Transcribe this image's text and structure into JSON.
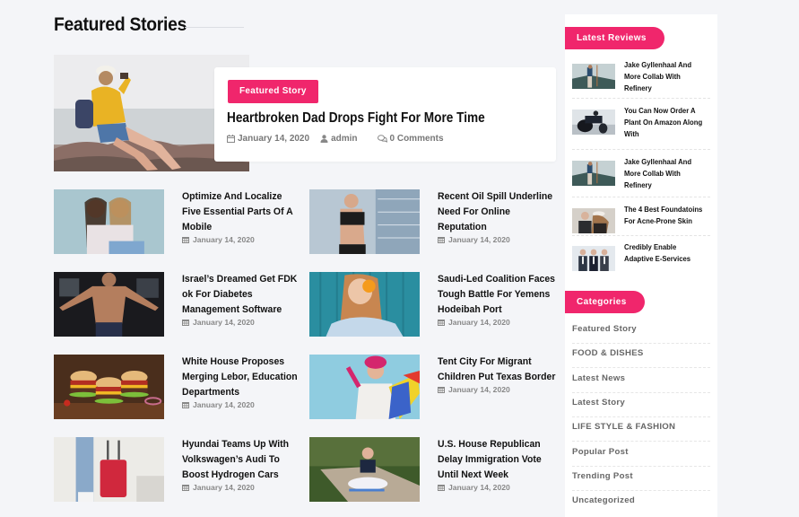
{
  "section": {
    "title": "Featured Stories"
  },
  "featured": {
    "badge": "Featured Story",
    "title": "Heartbroken Dad Drops Fight For More Time",
    "date": "January 14, 2020",
    "author": "admin",
    "comments": "0 Comments",
    "image": "woman-taking-photo-on-rocks"
  },
  "posts": [
    {
      "title": "Optimize And Localize Five Essential Parts Of A Mobile",
      "date": "January 14, 2020",
      "image": "two-girls-pointing-up"
    },
    {
      "title": "Recent Oil Spill Underline Need For Online Reputation",
      "date": "January 14, 2020",
      "image": "woman-checking-fitness-watch"
    },
    {
      "title": "Israel’s Dreamed Get FDK ok For Diabetes Management Software",
      "date": "January 14, 2020",
      "image": "man-working-out-gym"
    },
    {
      "title": "Saudi-Led Coalition Faces Tough Battle For Yemens Hodeibah Port",
      "date": "January 14, 2020",
      "image": "woman-with-orange-slice"
    },
    {
      "title": "White House Proposes Merging Lebor, Education Departments",
      "date": "January 14, 2020",
      "image": "burgers-on-board"
    },
    {
      "title": "Tent City For Migrant Children Put Texas Border",
      "date": "January 14, 2020",
      "image": "girl-with-shopping-bags"
    },
    {
      "title": "Hyundai Teams Up With Volkswagen’s Audi To Boost Hydrogen Cars",
      "date": "January 14, 2020",
      "image": "person-with-red-suitcase"
    },
    {
      "title": "U.S. House Republican Delay Immigration Vote Until Next Week",
      "date": "January 14, 2020",
      "image": "woman-meditating-on-path"
    }
  ],
  "sidebar": {
    "reviews_title": "Latest Reviews",
    "reviews": [
      {
        "title": "Jake Gyllenhaal And More Collab With Refinery",
        "image": "hiker-on-mountain"
      },
      {
        "title": "You Can Now Order A Plant On Amazon Along With",
        "image": "motorcycle-rider"
      },
      {
        "title": "Jake Gyllenhaal And More Collab With Refinery",
        "image": "hiker-on-mountain"
      },
      {
        "title": "The 4 Best Foundatoins For Acne-Prone Skin",
        "image": "couple-in-winter"
      },
      {
        "title": "Credibly Enable Adaptive E-Services",
        "image": "business-team"
      }
    ],
    "categories_title": "Categories",
    "categories": [
      "Featured Story",
      "FOOD & DISHES",
      "Latest News",
      "Latest Story",
      "LIFE STYLE & FASHION",
      "Popular Post",
      "Trending Post",
      "Uncategorized"
    ]
  },
  "colors": {
    "accent": "#f0266c",
    "background": "#f4f5f8",
    "text": "#111111",
    "meta": "#888888"
  }
}
